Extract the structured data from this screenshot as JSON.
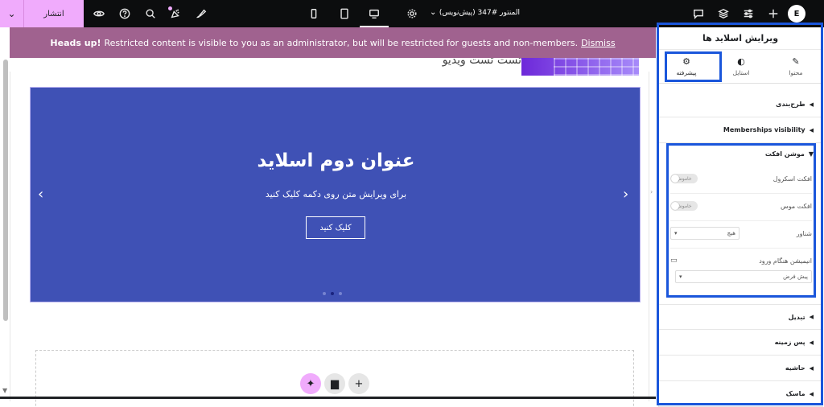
{
  "topbar": {
    "publish_label": "انتشار",
    "document_title": "المنتور #347 (پیش‌نویس)",
    "logo_text": "E"
  },
  "notice": {
    "heads_up": "Heads up!",
    "message": "Restricted content is visible to you as an administrator, but will be restricted for guests and non-members.",
    "dismiss": "Dismiss"
  },
  "canvas": {
    "header_text": "تست تست ویدیو",
    "slide": {
      "title": "عنوان دوم اسلاید",
      "description": "برای ویرایش متن روی دکمه کلیک کنید",
      "button": "کلیک کنید"
    }
  },
  "panel": {
    "title": "ویرایش اسلاید ها",
    "tabs": [
      {
        "label": "محتوا",
        "icon": "pencil-icon"
      },
      {
        "label": "استایل",
        "icon": "half-circle-icon"
      },
      {
        "label": "پیشرفته",
        "icon": "gear-icon"
      }
    ],
    "sections": {
      "layout": "طرح‌بندی",
      "memberships": "Memberships visibility",
      "motion": "موشن افکت",
      "transform": "تبدیل",
      "background": "پس زمینه",
      "border": "حاشیه",
      "mask": "ماسک"
    },
    "motion": {
      "scroll_label": "افکت اسکرول",
      "scroll_toggle": "خاموش",
      "mouse_label": "افکت موس",
      "mouse_toggle": "خاموش",
      "sticky_label": "شناور",
      "sticky_value": "هیچ",
      "entrance_label": "انیمیشن هنگام ورود",
      "entrance_value": "پیش فرض"
    }
  },
  "colors": {
    "accent_pink": "#f0abfc",
    "notice_bg": "#a0628f",
    "slide_bg": "#3f51b5",
    "highlight": "#1a56db"
  }
}
